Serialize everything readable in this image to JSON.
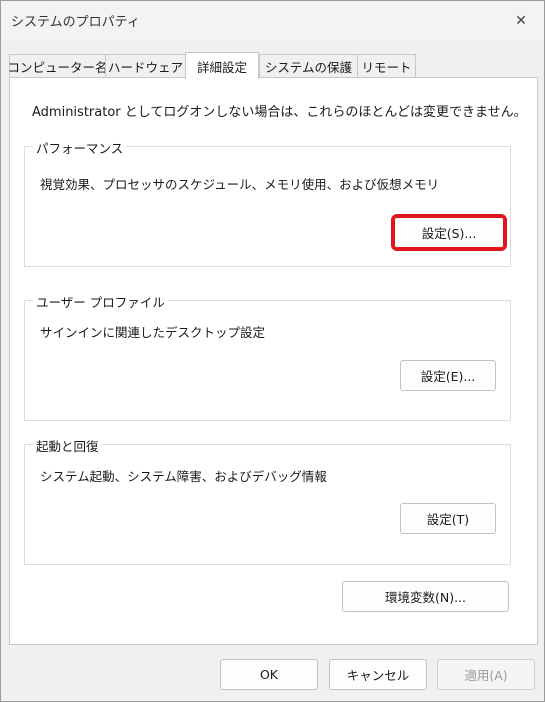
{
  "window": {
    "title": "システムのプロパティ",
    "close_glyph": "✕"
  },
  "tabs": [
    {
      "label": "コンピューター名"
    },
    {
      "label": "ハードウェア"
    },
    {
      "label": "詳細設定",
      "active": true
    },
    {
      "label": "システムの保護"
    },
    {
      "label": "リモート"
    }
  ],
  "notice": "Administrator としてログオンしない場合は、これらのほとんどは変更できません。",
  "groups": {
    "performance": {
      "title": "パフォーマンス",
      "description": "視覚効果、プロセッサのスケジュール、メモリ使用、および仮想メモリ",
      "button": "設定(S)..."
    },
    "user_profile": {
      "title": "ユーザー プロファイル",
      "description": "サインインに関連したデスクトップ設定",
      "button": "設定(E)..."
    },
    "startup_recovery": {
      "title": "起動と回復",
      "description": "システム起動、システム障害、およびデバッグ情報",
      "button": "設定(T)"
    }
  },
  "env_button": "環境変数(N)...",
  "footer": {
    "ok": "OK",
    "cancel": "キャンセル",
    "apply": "適用(A)"
  },
  "colors": {
    "highlight": "#e0161e"
  }
}
